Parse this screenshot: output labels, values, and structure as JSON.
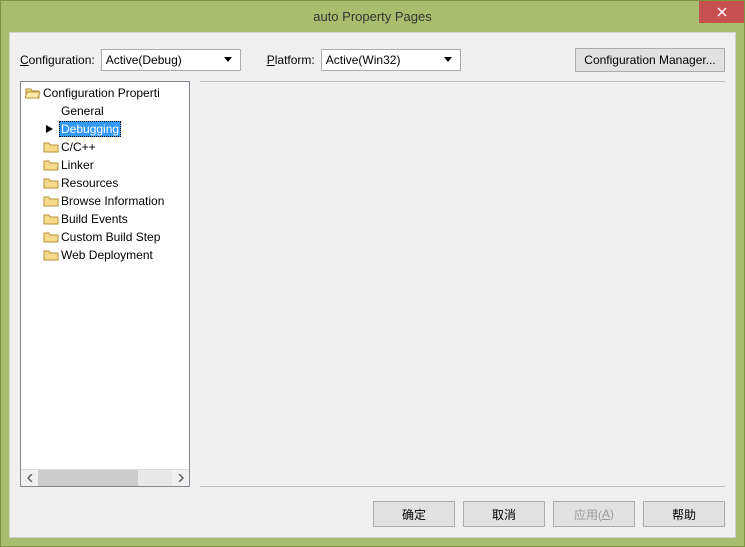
{
  "window": {
    "title": "auto Property Pages"
  },
  "toolbar": {
    "configuration_label_pre": "C",
    "configuration_label_rest": "onfiguration:",
    "configuration_value": "Active(Debug)",
    "platform_label_pre": "P",
    "platform_label_rest": "latform:",
    "platform_value": "Active(Win32)",
    "config_manager_label": "Configuration Manager..."
  },
  "tree": {
    "root_label": "Configuration Properti",
    "items": [
      {
        "label": "General",
        "type": "plain"
      },
      {
        "label": "Debugging",
        "type": "plain",
        "selected": true,
        "arrow": true
      },
      {
        "label": "C/C++",
        "type": "folder"
      },
      {
        "label": "Linker",
        "type": "folder"
      },
      {
        "label": "Resources",
        "type": "folder"
      },
      {
        "label": "Browse Information",
        "type": "folder"
      },
      {
        "label": "Build Events",
        "type": "folder"
      },
      {
        "label": "Custom Build Step",
        "type": "folder"
      },
      {
        "label": "Web Deployment",
        "type": "folder"
      }
    ]
  },
  "buttons": {
    "ok": "确定",
    "cancel": "取消",
    "apply_pre": "应用(",
    "apply_u": "A",
    "apply_post": ")",
    "help": "帮助"
  }
}
